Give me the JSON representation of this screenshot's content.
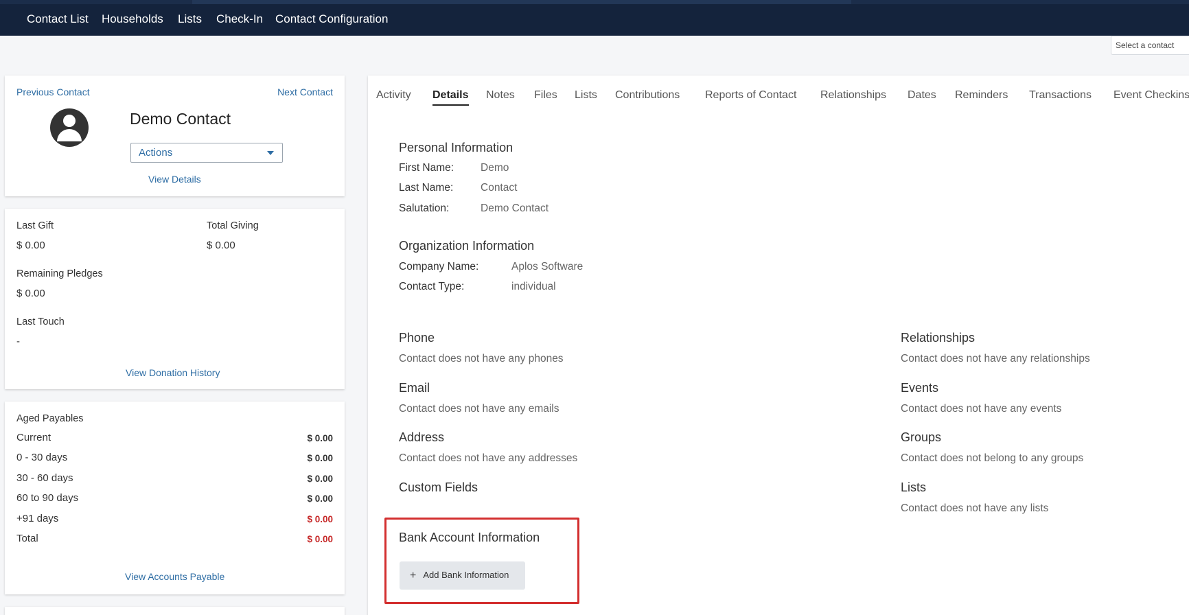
{
  "nav": {
    "items": [
      "Contact List",
      "Households",
      "Lists",
      "Check-In",
      "Contact Configuration"
    ]
  },
  "contact_select": {
    "placeholder": "Select a contact"
  },
  "profile": {
    "previous": "Previous Contact",
    "next": "Next Contact",
    "name": "Demo Contact",
    "actions": "Actions",
    "view_details": "View Details"
  },
  "giving": {
    "last_gift_label": "Last Gift",
    "last_gift": "$ 0.00",
    "total_giving_label": "Total Giving",
    "total_giving": "$ 0.00",
    "remaining_pledges_label": "Remaining Pledges",
    "remaining_pledges": "$ 0.00",
    "last_touch_label": "Last Touch",
    "last_touch": "-",
    "view_history": "View Donation History"
  },
  "payables": {
    "title": "Aged Payables",
    "rows": [
      {
        "label": "Current",
        "amount": "$ 0.00"
      },
      {
        "label": "0 - 30 days",
        "amount": "$ 0.00"
      },
      {
        "label": "30 - 60 days",
        "amount": "$ 0.00"
      },
      {
        "label": "60 to 90 days",
        "amount": "$ 0.00"
      },
      {
        "label": "+91 days",
        "amount": "$ 0.00"
      },
      {
        "label": "Total",
        "amount": "$ 0.00"
      }
    ],
    "view_link": "View Accounts Payable",
    "alert_color": "#c62828"
  },
  "tabs": [
    "Activity",
    "Details",
    "Notes",
    "Files",
    "Lists",
    "Contributions",
    "Reports of Contact",
    "Relationships",
    "Dates",
    "Reminders",
    "Transactions",
    "Event Checkins"
  ],
  "details": {
    "personal": {
      "title": "Personal Information",
      "first_name_label": "First Name:",
      "first_name": "Demo",
      "last_name_label": "Last Name:",
      "last_name": "Contact",
      "salutation_label": "Salutation:",
      "salutation": "Demo Contact"
    },
    "organization": {
      "title": "Organization Information",
      "company_label": "Company Name:",
      "company": "Aplos Software",
      "type_label": "Contact Type:",
      "type": "individual"
    },
    "phone": {
      "title": "Phone",
      "empty": "Contact does not have any phones"
    },
    "email": {
      "title": "Email",
      "empty": "Contact does not have any emails"
    },
    "address": {
      "title": "Address",
      "empty": "Contact does not have any addresses"
    },
    "custom_fields": {
      "title": "Custom Fields"
    },
    "relationships": {
      "title": "Relationships",
      "empty": "Contact does not have any relationships"
    },
    "events": {
      "title": "Events",
      "empty": "Contact does not have any events"
    },
    "groups": {
      "title": "Groups",
      "empty": "Contact does not belong to any groups"
    },
    "lists": {
      "title": "Lists",
      "empty": "Contact does not have any lists"
    },
    "bank": {
      "title": "Bank Account Information",
      "add_button": "Add Bank Information"
    }
  },
  "colors": {
    "nav_bg": "#14233c",
    "link": "#2e6da4",
    "highlight": "#d32f2f"
  }
}
